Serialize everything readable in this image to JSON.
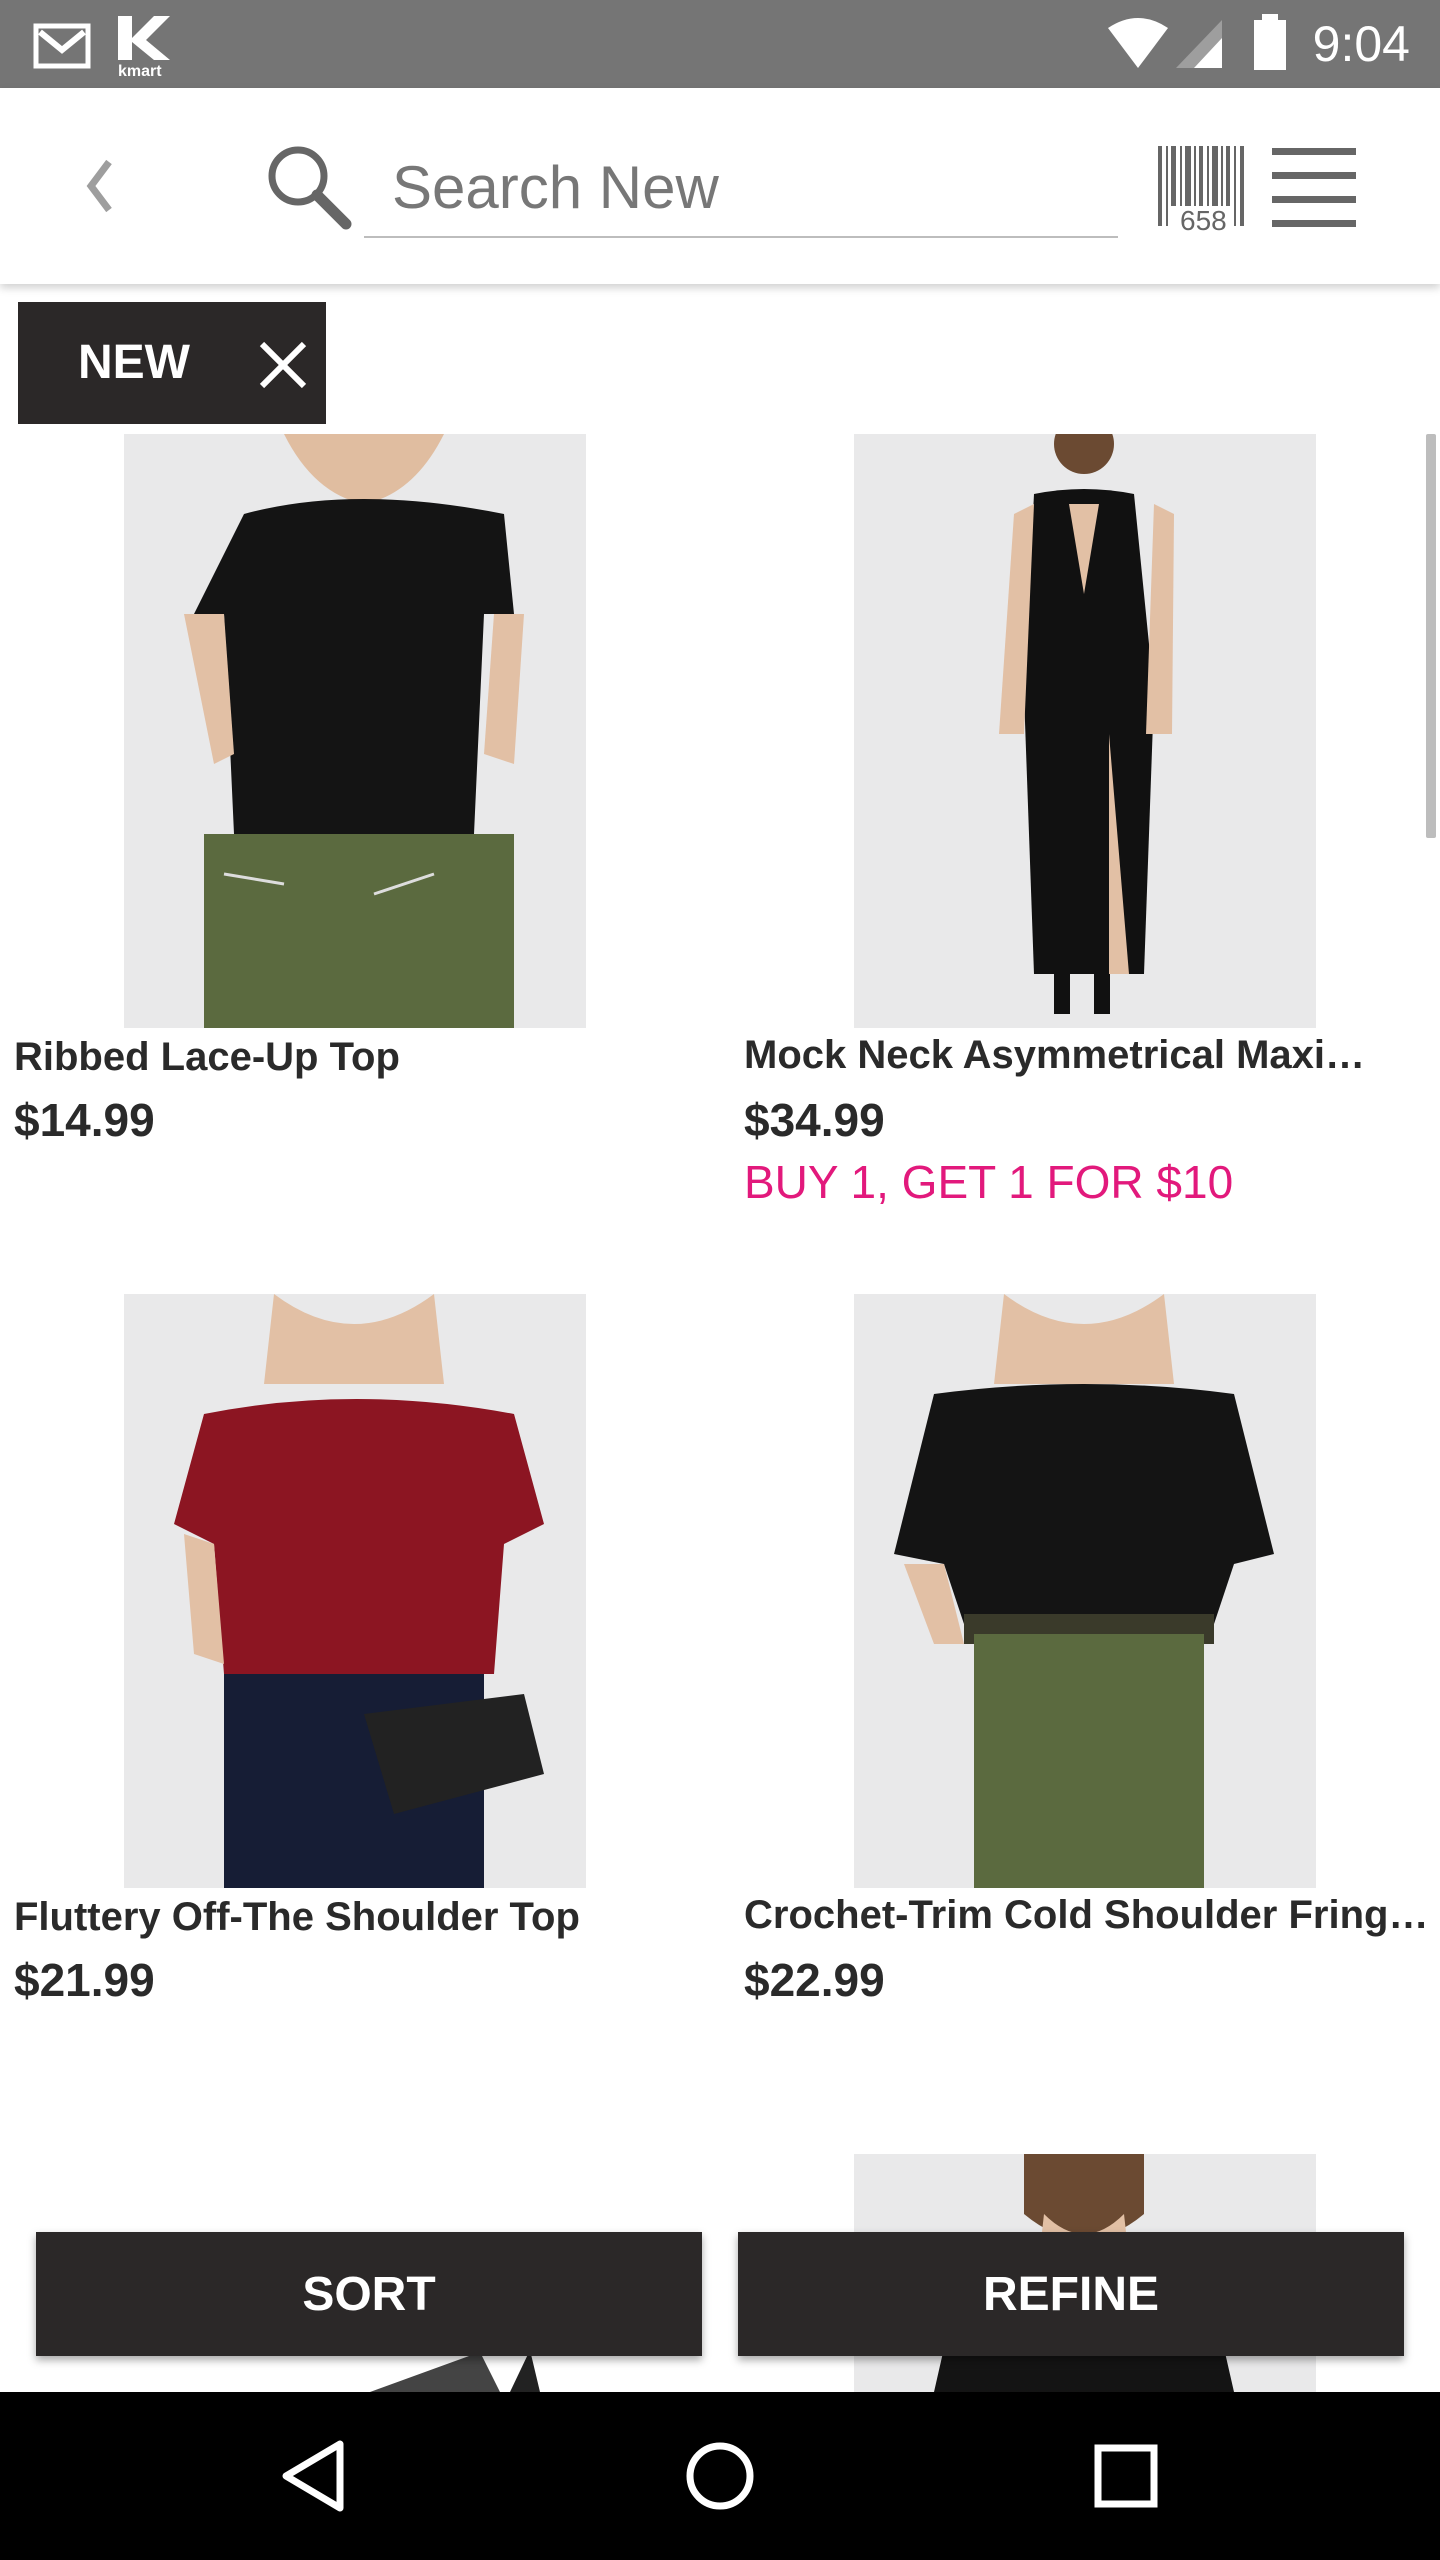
{
  "status_bar": {
    "time": "9:04",
    "icons": [
      "gmail-icon",
      "kmart-app-icon",
      "wifi-icon",
      "cell-signal-icon",
      "battery-icon"
    ],
    "kmart_icon_text": "kmart"
  },
  "header": {
    "back_icon": "chevron-left-icon",
    "search_placeholder": "Search New",
    "search_value": "",
    "barcode_icon": "barcode-scanner-icon",
    "barcode_number": "658",
    "menu_icon": "hamburger-menu-icon"
  },
  "filter_chip": {
    "label": "NEW",
    "close_icon": "close-icon"
  },
  "products": [
    {
      "name": "Ribbed Lace-Up Top",
      "price": "$14.99",
      "promo": ""
    },
    {
      "name": "Mock Neck Asymmetrical Maxi…",
      "price": "$34.99",
      "promo": "BUY 1, GET 1 FOR $10"
    },
    {
      "name": "Fluttery Off-The Shoulder Top",
      "price": "$21.99",
      "promo": ""
    },
    {
      "name": "Crochet-Trim Cold Shoulder Fring…",
      "price": "$22.99",
      "promo": ""
    }
  ],
  "actions": {
    "sort_label": "SORT",
    "refine_label": "REFINE"
  },
  "nav_bar": {
    "icons": [
      "back-triangle-icon",
      "home-circle-icon",
      "recents-square-icon"
    ]
  },
  "colors": {
    "status_bar": "#757575",
    "dark_button": "#2b2828",
    "promo_pink": "#e2197c",
    "image_background": "#e9e9ea"
  }
}
